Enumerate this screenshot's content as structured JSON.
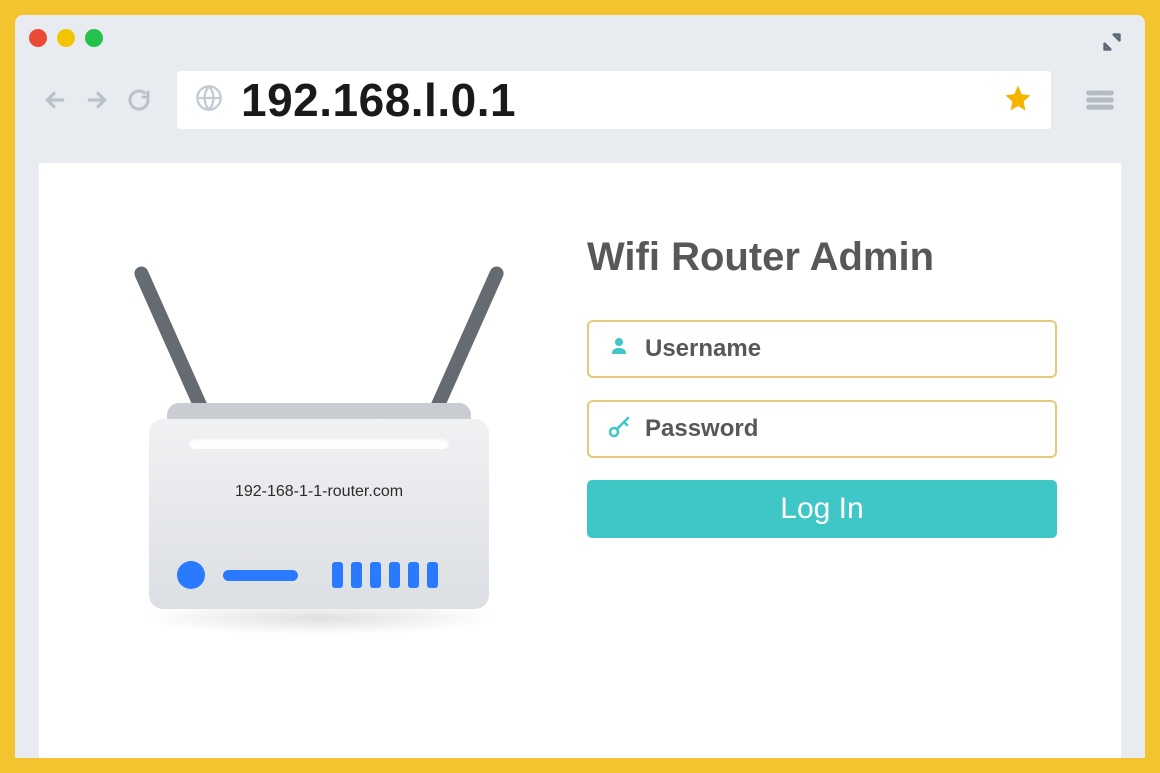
{
  "browser": {
    "url": "192.168.l.0.1"
  },
  "router_illustration": {
    "label": "192-168-1-1-router.com"
  },
  "login": {
    "title": "Wifi Router Admin",
    "username_placeholder": "Username",
    "password_placeholder": "Password",
    "button_label": "Log In"
  }
}
